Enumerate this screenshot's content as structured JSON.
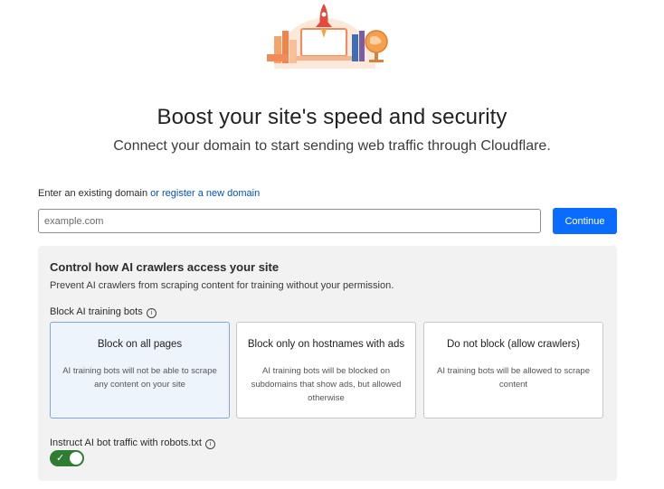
{
  "header": {
    "title": "Boost your site's speed and security",
    "subtitle": "Connect your domain to start sending web traffic through Cloudflare."
  },
  "domain": {
    "label_prefix": "Enter an existing domain",
    "register_link": "or register a new domain",
    "placeholder": "example.com",
    "value": "",
    "continue_label": "Continue"
  },
  "ai_panel": {
    "title": "Control how AI crawlers access your site",
    "description": "Prevent AI crawlers from scraping content for training without your permission.",
    "block_label": "Block AI training bots",
    "options": [
      {
        "title": "Block on all pages",
        "description": "AI training bots will not be able to scrape any content on your site",
        "selected": true
      },
      {
        "title": "Block only on hostnames with ads",
        "description": "AI training bots will be blocked on subdomains that show ads, but allowed otherwise",
        "selected": false
      },
      {
        "title": "Do not block (allow crawlers)",
        "description": "AI training bots will be allowed to scrape content",
        "selected": false
      }
    ],
    "robots_label": "Instruct AI bot traffic with robots.txt",
    "robots_enabled": true
  },
  "colors": {
    "accent": "#0a6cff",
    "link": "#0051c3",
    "toggle_on": "#2e7d32",
    "selected_bg": "#eef4fc"
  },
  "icons": [
    "rocket-hero-illustration",
    "info-icon",
    "check-icon"
  ]
}
